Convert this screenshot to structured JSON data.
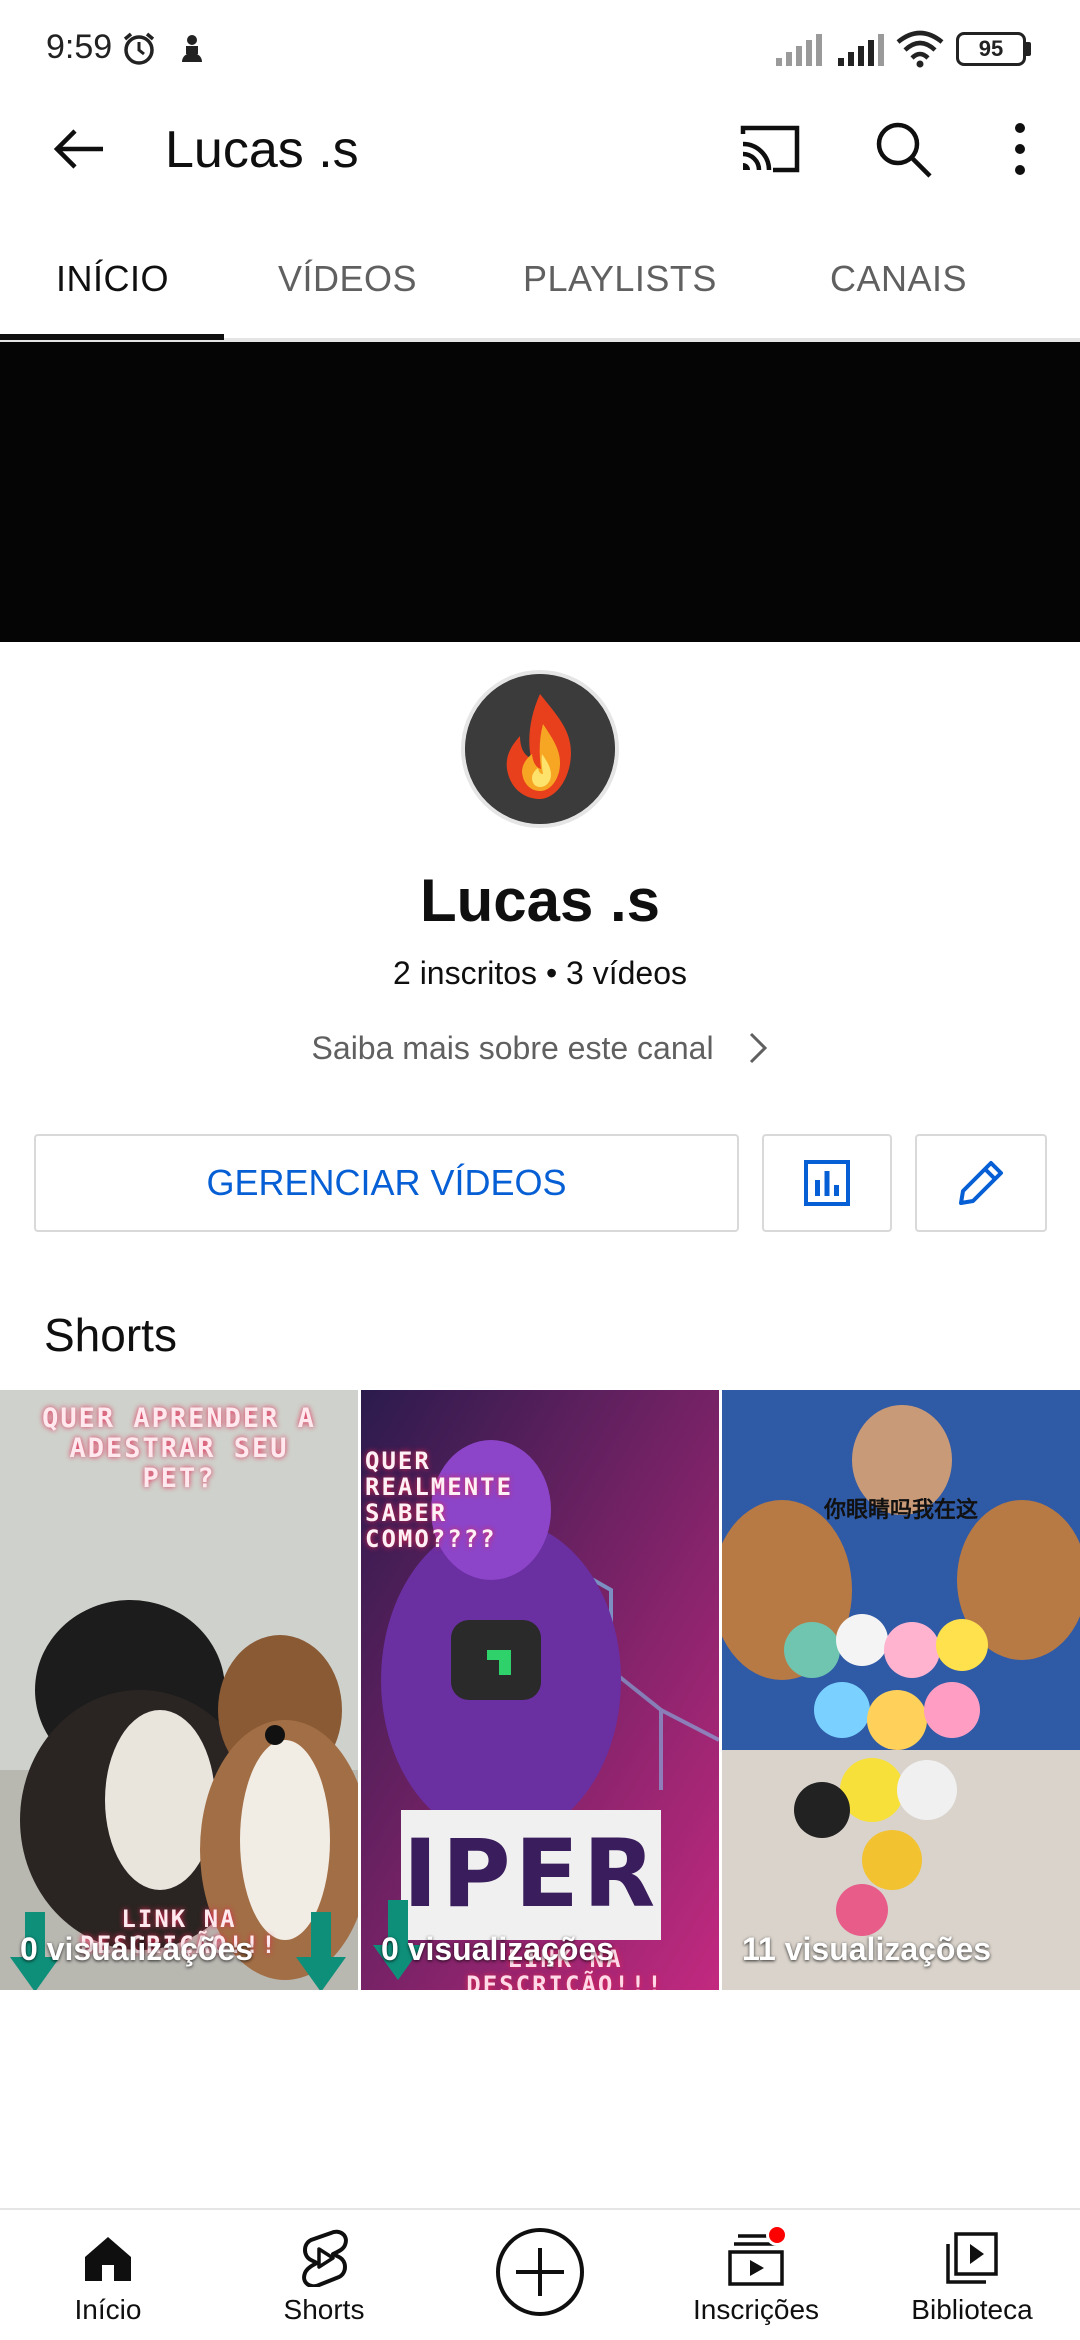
{
  "status_bar": {
    "time": "9:59",
    "battery": "95"
  },
  "app_bar": {
    "title": "Lucas .s"
  },
  "tabs": [
    {
      "label": "INÍCIO",
      "active": true
    },
    {
      "label": "VÍDEOS",
      "active": false
    },
    {
      "label": "PLAYLISTS",
      "active": false
    },
    {
      "label": "CANAIS",
      "active": false
    }
  ],
  "channel": {
    "name": "Lucas .s",
    "stats": "2 inscritos • 3 vídeos",
    "about_link": "Saiba mais sobre este canal"
  },
  "actions": {
    "manage_label": "GERENCIAR VÍDEOS"
  },
  "shorts": {
    "section_title": "Shorts",
    "items": [
      {
        "views": "0 visualizações",
        "caption_top": "QUER APRENDER A ADESTRAR SEU PET?",
        "caption_bottom": "LINK NA DESCRIÇÃO!!!"
      },
      {
        "views": "0 visualizações",
        "caption_top": "QUER REALMENTE SABER COMO????",
        "caption_bottom": "LINK NA DESCRIÇÃO!!!",
        "poster_text": "IPER"
      },
      {
        "views": "11 visualizações",
        "caption_top": "你眼睛吗我在这"
      }
    ]
  },
  "bottom_nav": [
    {
      "label": "Início",
      "icon": "home-icon",
      "active": true
    },
    {
      "label": "Shorts",
      "icon": "shorts-icon"
    },
    {
      "label": "",
      "icon": "create-icon"
    },
    {
      "label": "Inscrições",
      "icon": "subscriptions-icon",
      "badge": true
    },
    {
      "label": "Biblioteca",
      "icon": "library-icon"
    }
  ],
  "colors": {
    "link_blue": "#065fd4",
    "badge_red": "#ff0000",
    "banner": "#050505"
  }
}
